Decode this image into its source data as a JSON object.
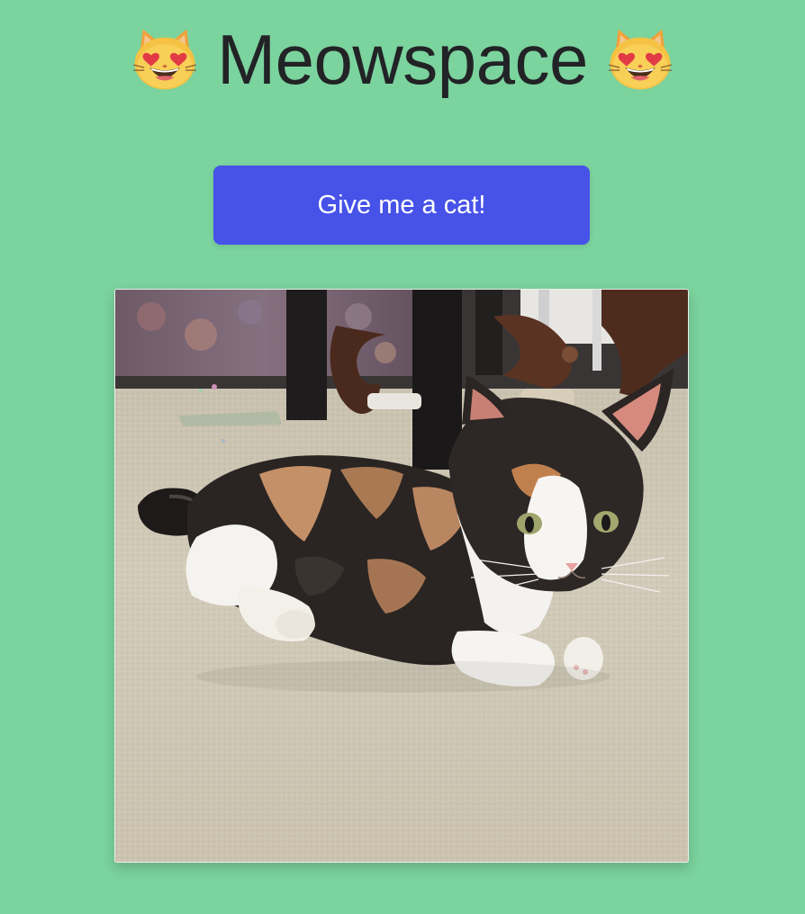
{
  "header": {
    "title": "Meowspace",
    "left_icon": "heart-eyes-cat-icon",
    "right_icon": "heart-eyes-cat-icon"
  },
  "button": {
    "label": "Give me a cat!"
  },
  "image": {
    "alt": "cat-photo",
    "subject": "calico kitten"
  },
  "colors": {
    "background": "#7bd39d",
    "button": "#4752e8",
    "title": "#222326"
  }
}
